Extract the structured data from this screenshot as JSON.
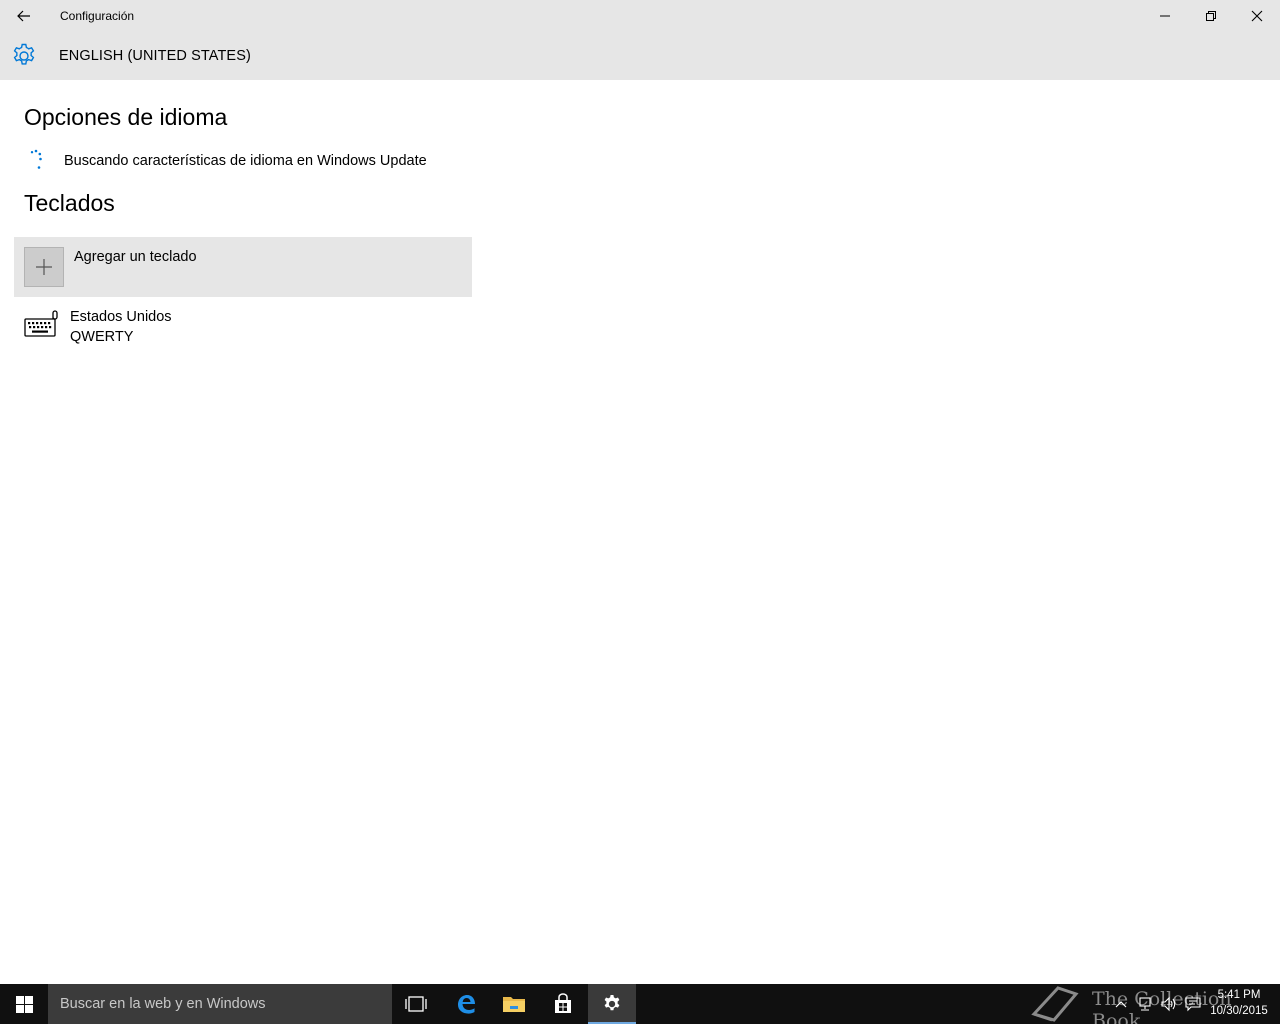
{
  "window": {
    "title": "Configuración",
    "back_icon": "back-arrow-icon",
    "controls": [
      "minimize-icon",
      "restore-icon",
      "close-icon"
    ]
  },
  "header": {
    "icon": "gear-icon",
    "title": "ENGLISH (UNITED STATES)",
    "icon_color": "#0078d7"
  },
  "language_options": {
    "heading": "Opciones de idioma",
    "status": "Buscando características de idioma en Windows Update",
    "status_icon": "loading-spinner-icon"
  },
  "keyboards": {
    "heading": "Teclados",
    "add_label": "Agregar un teclado",
    "items": [
      {
        "name": "Estados Unidos",
        "layout": "QWERTY",
        "icon": "keyboard-icon"
      }
    ]
  },
  "taskbar": {
    "search_placeholder": "Buscar en la web y en Windows",
    "pinned": [
      "task-view-icon",
      "edge-icon",
      "file-explorer-icon",
      "store-icon",
      "settings-icon"
    ],
    "active": "settings-icon",
    "watermark": "The Collection Book",
    "clock_time": "5:41 PM",
    "clock_date": "10/30/2015"
  },
  "colors": {
    "accent": "#0078d7",
    "chrome": "#e6e6e6",
    "taskbar": "#101010"
  }
}
